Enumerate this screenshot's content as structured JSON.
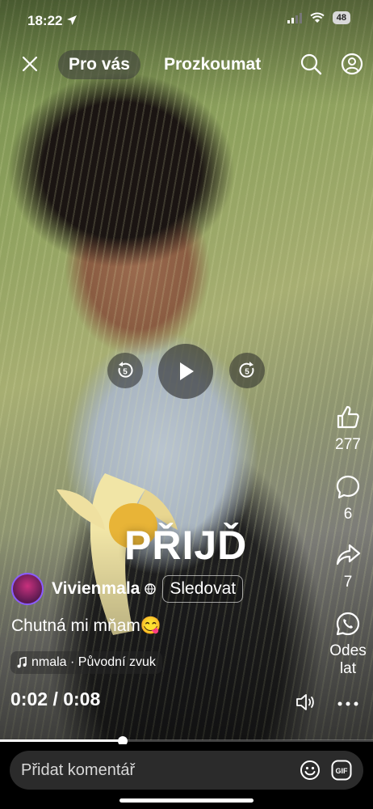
{
  "status_bar": {
    "time": "18:22",
    "battery": "48"
  },
  "topnav": {
    "tab_active": "Pro vás",
    "tab_explore": "Prozkoumat"
  },
  "controls": {
    "rewind_seconds": "5",
    "forward_seconds": "5"
  },
  "overlay_text": "PŘIJĎ",
  "actions": {
    "likes": "277",
    "comments": "6",
    "shares": "7",
    "send_line1": "Odes",
    "send_line2": "lat"
  },
  "post": {
    "author": "Vivienmala",
    "follow_label": "Sledovat",
    "caption": "Chutná mi mňam😋",
    "audio": "nmala · Původní zvuk"
  },
  "player": {
    "current": "0:02",
    "duration": "0:08",
    "separator": "/",
    "progress": 0.33
  },
  "comment": {
    "placeholder": "Přidat komentář"
  },
  "icons": [
    "navigation-arrow-icon",
    "signal-icon",
    "wifi-icon",
    "close-icon",
    "search-icon",
    "profile-icon",
    "rewind-5-icon",
    "play-icon",
    "forward-5-icon",
    "like-icon",
    "comment-icon",
    "share-icon",
    "whatsapp-icon",
    "more-icon",
    "globe-icon",
    "music-note-icon",
    "volume-icon",
    "emoji-icon",
    "gif-icon"
  ]
}
